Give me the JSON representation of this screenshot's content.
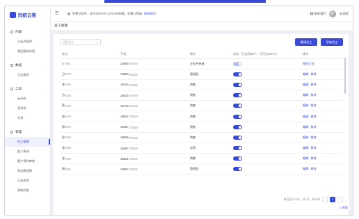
{
  "app": {
    "logo": "同航云客"
  },
  "header": {
    "notice": "免费试用中，终于2020-03-12 00:00到期。如需订购请",
    "notice_link": "联系我们",
    "contact": "联系我们",
    "user": "欢迎您"
  },
  "sidebar": {
    "groups": [
      {
        "label": "内容",
        "items": [
          "企业内容库",
          "我回复的内容"
        ]
      },
      {
        "label": "数据",
        "items": [
          "企业概况"
        ]
      },
      {
        "label": "工具",
        "items": [
          "云存码",
          "宣传页",
          "问卷"
        ]
      },
      {
        "label": "管理",
        "items": [
          "员工管理",
          "加入申请",
          "客户资料审核",
          "朋友圈设置",
          "企业信息",
          "系统功能"
        ]
      }
    ],
    "active": "员工管理"
  },
  "page": {
    "title": "员工管理"
  },
  "toolbar": {
    "search_placeholder": "搜索员工",
    "btn_invite": "邀请员工",
    "btn_add": "添加员工"
  },
  "table": {
    "headers": [
      "姓名",
      "手机",
      "角色",
      "状态（已启用30个，可开启200个）",
      "操作"
    ],
    "rows": [
      {
        "name": "A",
        "phone": "15656",
        "role": "企业所有者",
        "on": false,
        "ops": [
          "移交企业"
        ]
      },
      {
        "name": "日",
        "phone": "13663",
        "role": "管理员",
        "on": true,
        "ops": [
          "编辑",
          "移除"
        ]
      },
      {
        "name": "李",
        "phone": "18244",
        "role": "销售",
        "on": true,
        "ops": [
          "编辑",
          "移除"
        ]
      },
      {
        "name": "谷",
        "phone": "18822",
        "role": "销售",
        "on": true,
        "ops": [
          "编辑",
          "移除"
        ]
      },
      {
        "name": "蔡",
        "phone": "15716",
        "role": "销售",
        "on": true,
        "ops": [
          "编辑",
          "移除"
        ]
      },
      {
        "name": "林",
        "phone": "18057",
        "role": "销售",
        "on": true,
        "ops": [
          "编辑",
          "移除"
        ]
      },
      {
        "name": "郭",
        "phone": "15657",
        "role": "销售",
        "on": true,
        "ops": [
          "编辑",
          "移除"
        ]
      },
      {
        "name": "郭",
        "phone": "18606",
        "role": "销售",
        "on": true,
        "ops": [
          "编辑",
          "移除"
        ]
      },
      {
        "name": "张",
        "phone": "15657",
        "role": "运营",
        "on": true,
        "ops": [
          "编辑",
          "移除"
        ]
      },
      {
        "name": "张",
        "phone": "18821",
        "role": "销售",
        "on": true,
        "ops": [
          "编辑",
          "移除"
        ]
      },
      {
        "name": "胡",
        "phone": "18057",
        "role": "管理员",
        "on": true,
        "ops": [
          "编辑",
          "移除"
        ]
      }
    ]
  },
  "pager": {
    "info": "每页显示10条，共1页，共10条",
    "current": "1"
  },
  "help": "帮助"
}
